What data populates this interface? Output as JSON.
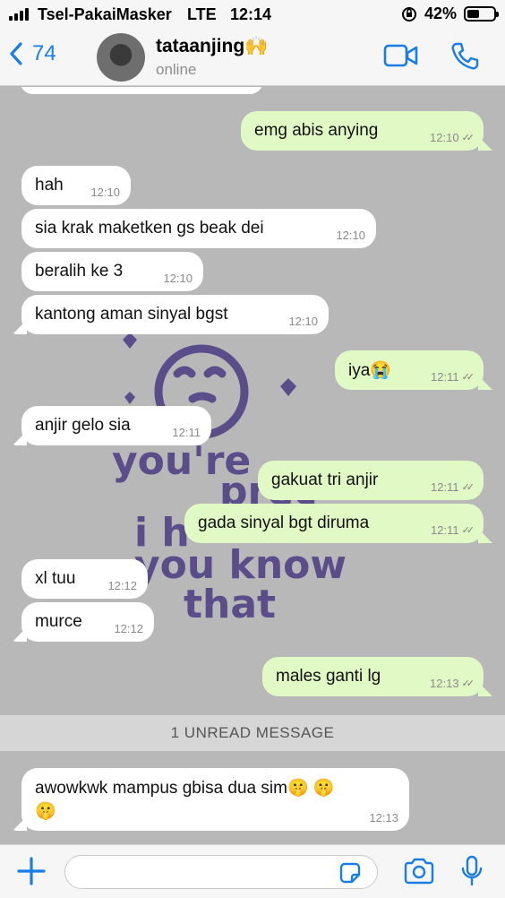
{
  "status_bar": {
    "carrier": "Tsel-PakaiMasker",
    "network": "LTE",
    "time": "12:14",
    "battery": "42%"
  },
  "header": {
    "back_count": "74",
    "contact_name": "tataanjing🙌",
    "contact_status": "online"
  },
  "messages": [
    {
      "dir": "out",
      "text": "emg abis anying",
      "time": "12:10",
      "ticks": "✓✓"
    },
    {
      "dir": "in",
      "text": "hah",
      "time": "12:10"
    },
    {
      "dir": "in",
      "text": "sia krak maketken gs beak dei",
      "time": "12:10"
    },
    {
      "dir": "in",
      "text": "beralih ke 3",
      "time": "12:10"
    },
    {
      "dir": "in",
      "text": "kantong aman sinyal bgst",
      "time": "12:10"
    },
    {
      "dir": "out",
      "text": "iya😭",
      "time": "12:11",
      "ticks": "✓✓"
    },
    {
      "dir": "in",
      "text": "anjir gelo sia",
      "time": "12:11"
    },
    {
      "dir": "out",
      "text": "gakuat tri anjir",
      "time": "12:11",
      "ticks": "✓✓"
    },
    {
      "dir": "out",
      "text": "gada sinyal bgt diruma",
      "time": "12:11",
      "ticks": "✓✓"
    },
    {
      "dir": "in",
      "text": "xl tuu",
      "time": "12:12"
    },
    {
      "dir": "in",
      "text": "murce",
      "time": "12:12"
    },
    {
      "dir": "out",
      "text": "males ganti lg",
      "time": "12:13",
      "ticks": "✓✓"
    },
    {
      "dir": "in",
      "text": "awowkwk mampus gbisa dua sim🤫 🤫",
      "text_line2": "🤫",
      "time": "12:13"
    }
  ],
  "unread_banner": "1 UNREAD MESSAGE",
  "wallpaper_text": [
    "you're",
    "prec",
    "i h",
    "you know",
    "that"
  ],
  "input": {
    "placeholder": "",
    "value": ""
  },
  "icons": {
    "back": "chevron-left-icon",
    "video": "video-camera-icon",
    "call": "phone-icon",
    "plus": "plus-icon",
    "sticker": "sticker-icon",
    "camera": "camera-icon",
    "mic": "microphone-icon"
  },
  "colors": {
    "accent": "#1a7de5",
    "out_bubble": "#e1f9c5",
    "in_bubble": "#ffffff",
    "wallpaper_ink": "#5b4c8a"
  }
}
